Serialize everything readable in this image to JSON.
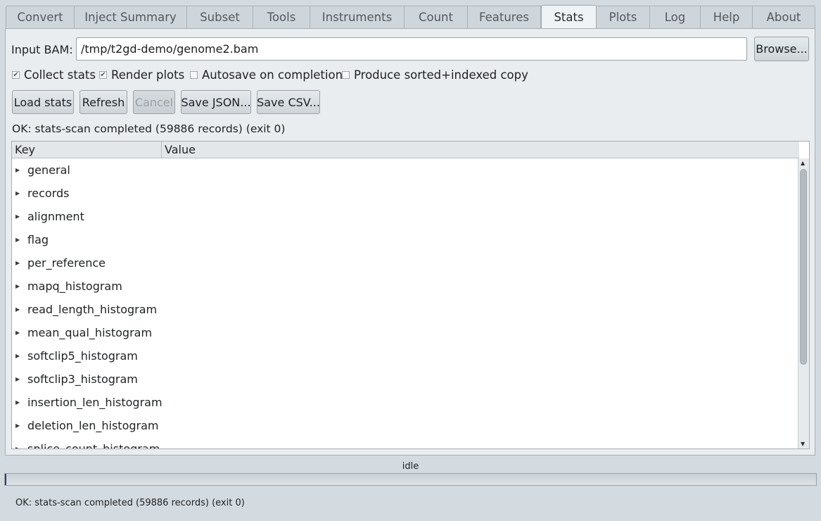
{
  "tabs": [
    {
      "label": "Convert",
      "active": false
    },
    {
      "label": "Inject Summary",
      "active": false
    },
    {
      "label": "Subset",
      "active": false
    },
    {
      "label": "Tools",
      "active": false
    },
    {
      "label": "Instruments",
      "active": false
    },
    {
      "label": "Count",
      "active": false
    },
    {
      "label": "Features",
      "active": false
    },
    {
      "label": "Stats",
      "active": true
    },
    {
      "label": "Plots",
      "active": false
    },
    {
      "label": "Log",
      "active": false
    },
    {
      "label": "Help",
      "active": false
    },
    {
      "label": "About",
      "active": false
    }
  ],
  "input": {
    "label": "Input BAM:",
    "value": "/tmp/t2gd-demo/genome2.bam",
    "browse_label": "Browse..."
  },
  "options": [
    {
      "label": "Collect stats",
      "checked": true
    },
    {
      "label": "Render plots",
      "checked": true
    },
    {
      "label": "Autosave on completion",
      "checked": false
    },
    {
      "label": "Produce sorted+indexed copy",
      "checked": false
    }
  ],
  "actions": {
    "load": "Load stats",
    "refresh": "Refresh",
    "cancel": "Cancel",
    "save_json": "Save JSON...",
    "save_csv": "Save CSV..."
  },
  "status_top": "OK: stats-scan completed (59886 records)  (exit 0)",
  "tree": {
    "columns": [
      "Key",
      "Value"
    ],
    "rows": [
      "general",
      "records",
      "alignment",
      "flag",
      "per_reference",
      "mapq_histogram",
      "read_length_histogram",
      "mean_qual_histogram",
      "softclip5_histogram",
      "softclip3_histogram",
      "insertion_len_histogram",
      "deletion_len_histogram",
      "splice_count_histogram"
    ]
  },
  "progress": {
    "label": "idle",
    "fraction": 0.002
  },
  "status_bottom": "OK: stats-scan completed (59886 records)  (exit 0)",
  "colors": {
    "progress_fill": "#2b3f7c",
    "panel_bg": "#e9edf0"
  }
}
